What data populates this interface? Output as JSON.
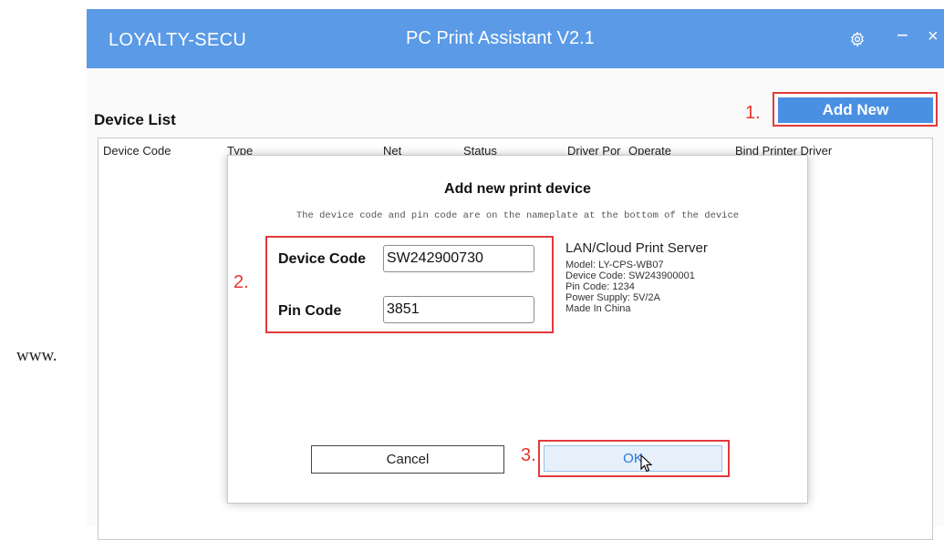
{
  "doc": {
    "text": "www."
  },
  "app": {
    "brand": "LOYALTY-SECU",
    "title": "PC Print Assistant V2.1",
    "minimize": "−",
    "close": "×"
  },
  "device_list": {
    "heading": "Device List",
    "step1": "1.",
    "add_label": "Add New",
    "columns": [
      "Device Code",
      "Type",
      "Net",
      "Status",
      "Driver Por",
      "Operate",
      "Bind Printer Driver"
    ]
  },
  "dialog": {
    "title": "Add new print device",
    "hint": "The device code and pin code are on the nameplate at the bottom of the device",
    "step2": "2.",
    "device_code_label": "Device Code",
    "device_code_value": "SW242900730",
    "pin_code_label": "Pin Code",
    "pin_code_value": "3851",
    "nameplate": {
      "title": "LAN/Cloud Print Server",
      "lines": [
        "Model: LY-CPS-WB07",
        "Device Code: SW243900001",
        "Pin Code: 1234",
        "Power Supply: 5V/2A",
        "Made In China"
      ]
    },
    "cancel_label": "Cancel",
    "step3": "3.",
    "ok_label": "OK"
  },
  "colors": {
    "titlebar": "#5a9ae6",
    "accent": "#4a90e2",
    "highlight": "#e23a3a"
  },
  "icons": [
    "gear-icon",
    "minimize-icon",
    "close-icon",
    "cursor-icon"
  ]
}
